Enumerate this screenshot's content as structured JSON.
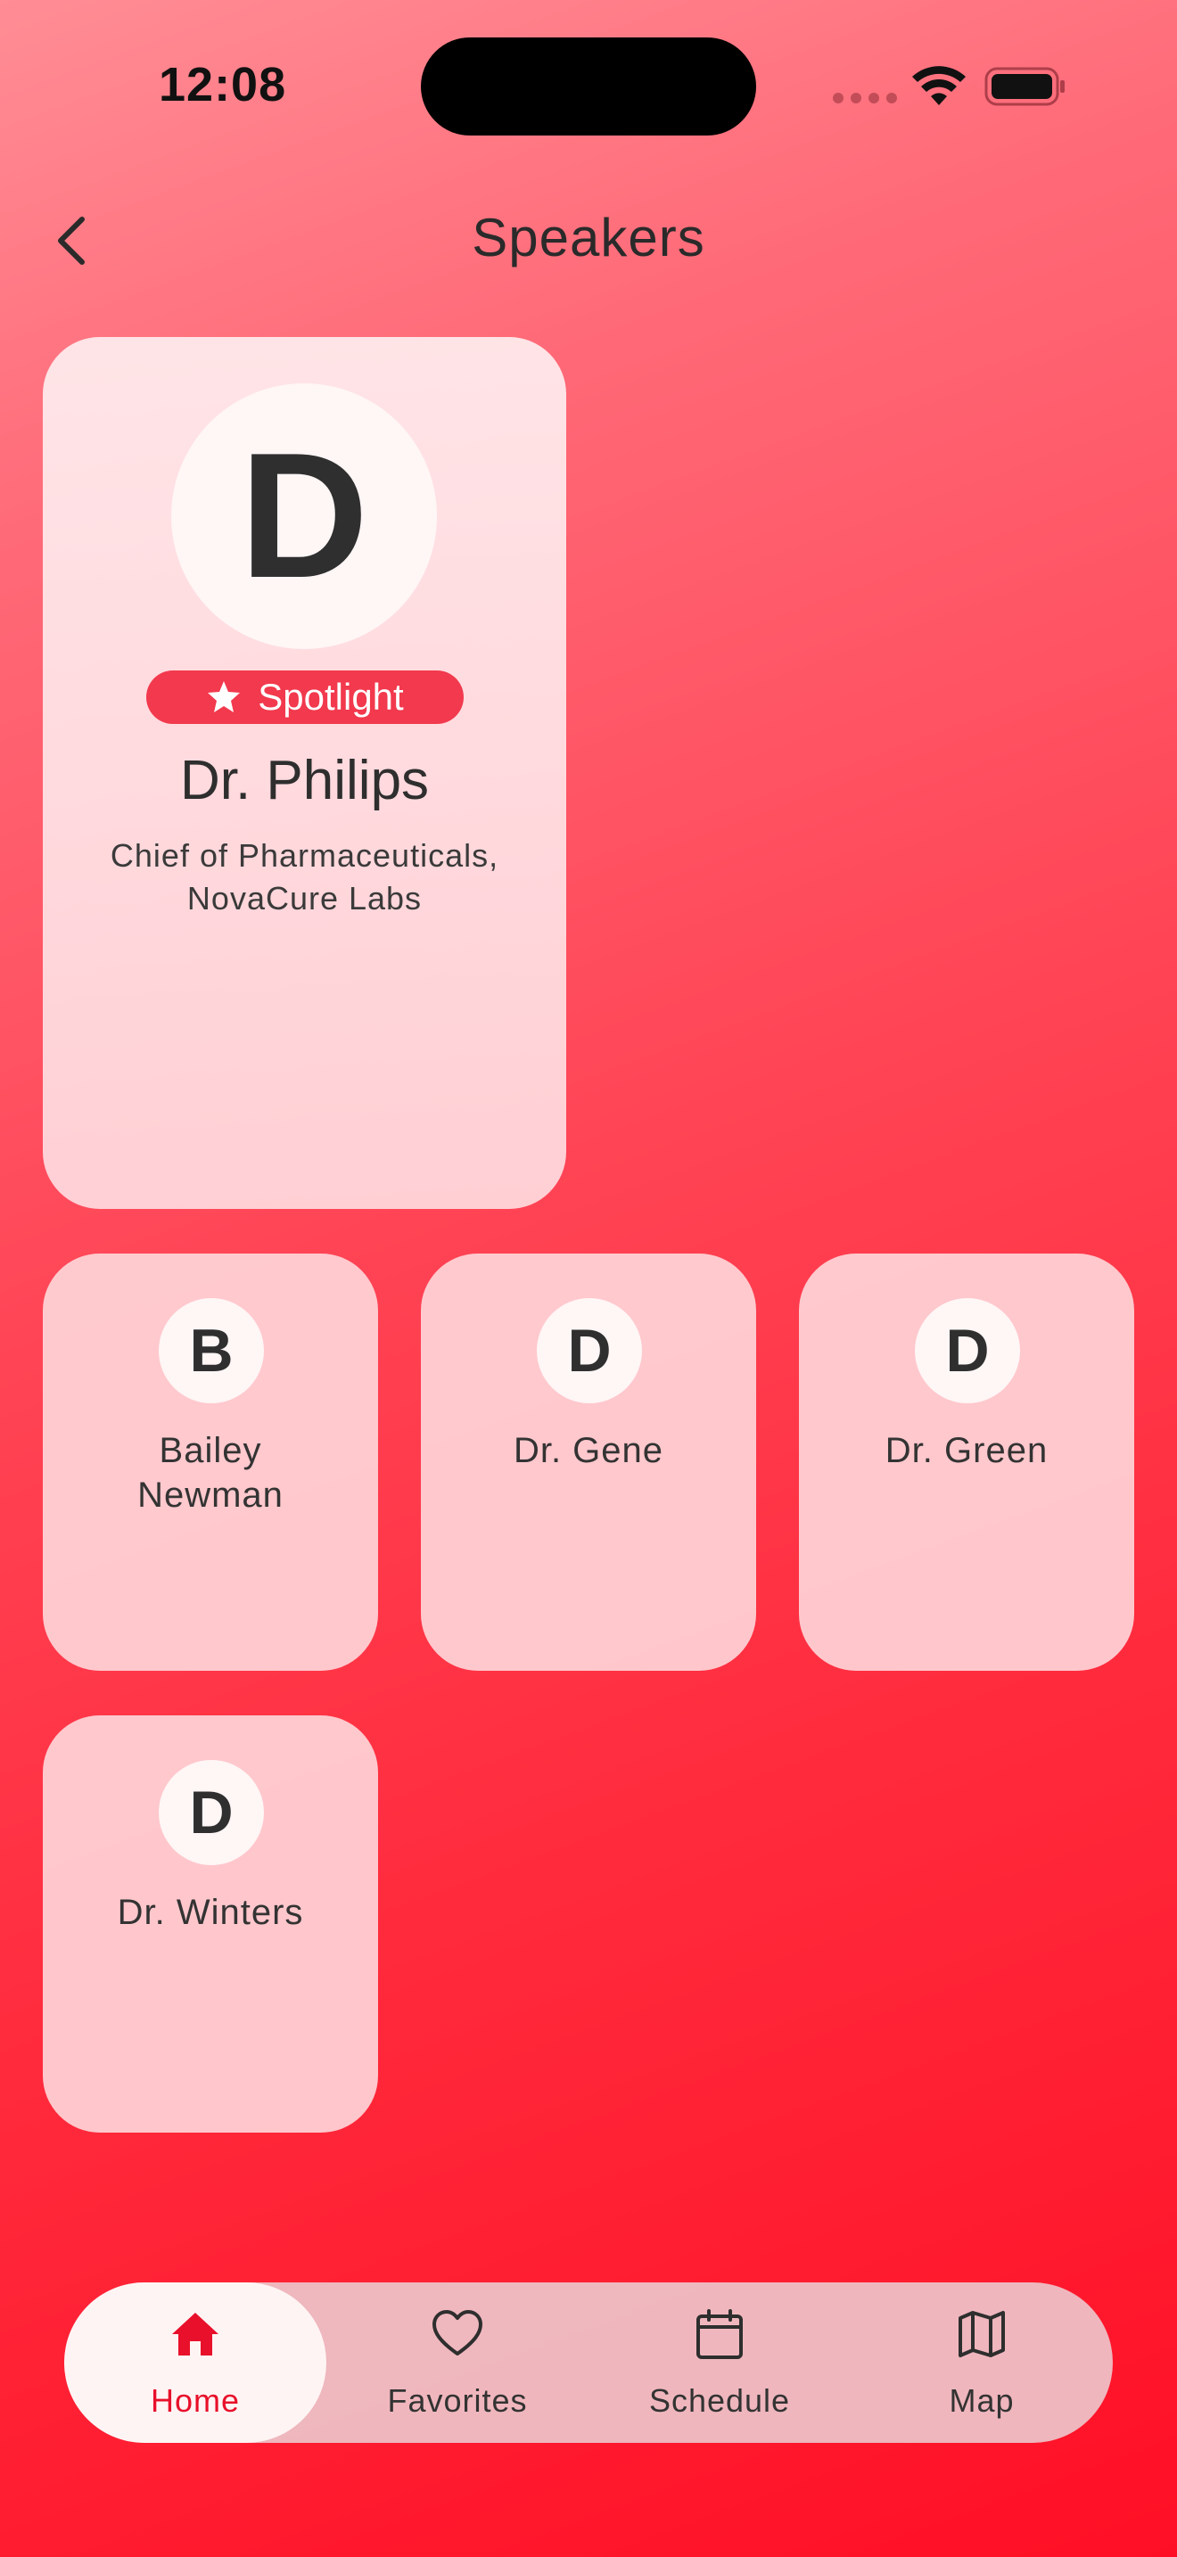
{
  "status_bar": {
    "time": "12:08"
  },
  "header": {
    "title": "Speakers"
  },
  "spotlight": {
    "initial": "D",
    "badge": "Spotlight",
    "name": "Dr. Philips",
    "role_line1": "Chief of Pharmaceuticals,",
    "role_line2": "NovaCure Labs"
  },
  "speakers": [
    {
      "initial": "B",
      "name_line1": "Bailey",
      "name_line2": "Newman"
    },
    {
      "initial": "D",
      "name_line1": "Dr. Gene",
      "name_line2": ""
    },
    {
      "initial": "D",
      "name_line1": "Dr. Green",
      "name_line2": ""
    },
    {
      "initial": "D",
      "name_line1": "Dr. Winters",
      "name_line2": ""
    }
  ],
  "tabs": [
    {
      "label": "Home",
      "icon": "home-icon",
      "active": true
    },
    {
      "label": "Favorites",
      "icon": "heart-icon",
      "active": false
    },
    {
      "label": "Schedule",
      "icon": "calendar-icon",
      "active": false
    },
    {
      "label": "Map",
      "icon": "map-icon",
      "active": false
    }
  ],
  "colors": {
    "accent": "#e8102a",
    "badge": "#f2394d"
  }
}
